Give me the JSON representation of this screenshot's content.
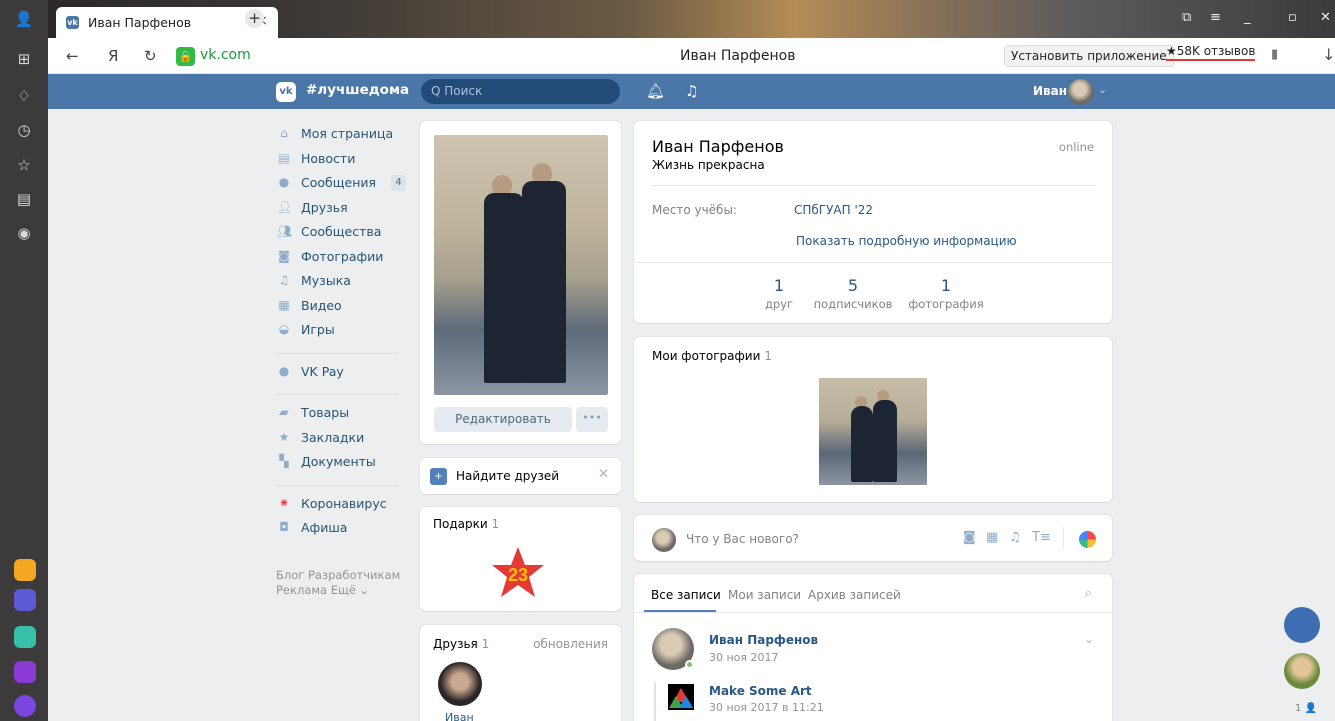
{
  "browser": {
    "tab_title": "Иван Парфенов",
    "tab_close": "×",
    "new_tab": "+",
    "domain": "vk.com",
    "page_title": "Иван Парфенов",
    "install_label": "Установить приложение",
    "reviews_label": "★58K отзывов"
  },
  "vk": {
    "logo": "vk",
    "hashtag": "#лучшедома",
    "search_placeholder": "Q Поиск",
    "user_name": "Иван"
  },
  "menu": {
    "items": [
      {
        "label": "Моя страница",
        "icon": "home-icon"
      },
      {
        "label": "Новости",
        "icon": "news-icon"
      },
      {
        "label": "Сообщения",
        "icon": "messages-icon",
        "count": "4"
      },
      {
        "label": "Друзья",
        "icon": "friends-icon"
      },
      {
        "label": "Сообщества",
        "icon": "groups-icon"
      },
      {
        "label": "Фотографии",
        "icon": "camera-icon"
      },
      {
        "label": "Музыка",
        "icon": "music-icon"
      },
      {
        "label": "Видео",
        "icon": "video-icon"
      },
      {
        "label": "Игры",
        "icon": "gamepad-icon"
      },
      {
        "label": "VK Pay",
        "icon": "vkpay-icon"
      },
      {
        "label": "Товары",
        "icon": "bag-icon"
      },
      {
        "label": "Закладки",
        "icon": "star-icon"
      },
      {
        "label": "Документы",
        "icon": "document-icon"
      },
      {
        "label": "Коронавирус",
        "icon": "virus-icon"
      },
      {
        "label": "Афиша",
        "icon": "ticket-icon"
      }
    ],
    "footer_line1": "Блог  Разработчикам",
    "footer_line2": "Реклама  Ещё ⌄"
  },
  "profile": {
    "edit_label": "Редактировать",
    "more_label": "•••",
    "find_friends": "Найдите друзей",
    "gifts_title": "Подарки",
    "gifts_count": "1",
    "friends_title": "Друзья",
    "friends_count": "1",
    "friends_updates": "обновления",
    "friend_name": "Иван",
    "name": "Иван Парфенов",
    "status": "Жизнь прекрасна",
    "online": "online",
    "study_label": "Место учёбы:",
    "study_value": "СПбГУАП '22",
    "more_info": "Показать подробную информацию",
    "stats": [
      {
        "n": "1",
        "l": "друг"
      },
      {
        "n": "5",
        "l": "подписчиков"
      },
      {
        "n": "1",
        "l": "фотография"
      }
    ],
    "photos_title": "Мои фотографии",
    "photos_count": "1"
  },
  "wall": {
    "composer_placeholder": "Что у Вас нового?",
    "tabs": [
      "Все записи",
      "Мои записи",
      "Архив записей"
    ],
    "post_author": "Иван Парфенов",
    "post_date": "30 ноя 2017",
    "repost_author": "Make Some Art",
    "repost_date": "30 ноя 2017 в 11:21"
  },
  "floating": {
    "count": "1 👤"
  },
  "colors": {
    "vk_blue": "#4a76a8",
    "link": "#2a5885",
    "page_bg": "#edeef0"
  }
}
